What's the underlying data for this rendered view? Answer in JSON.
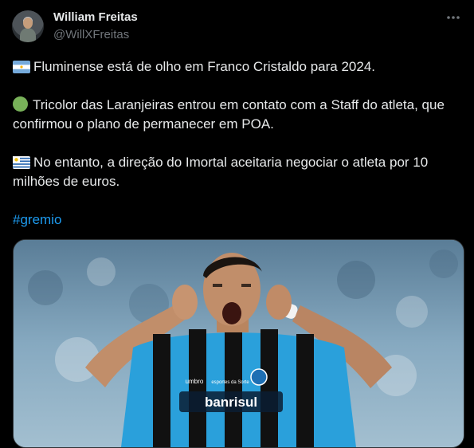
{
  "author": {
    "name": "William Freitas",
    "handle": "@WillXFreitas",
    "avatar_icon": "user-avatar"
  },
  "more_icon": "more-horizontal-icon",
  "tweet": {
    "paragraph1": "Fluminense está de olho em Franco Cristaldo para 2024.",
    "paragraph2_line1": "Tricolor das Laranjeiras entrou em contato com a Staff do atleta, que",
    "paragraph2_line2": "confirmou o plano de permanecer em POA.",
    "paragraph3_line1": "No entanto, a direção do Imortal aceitaria negociar o atleta por 10",
    "paragraph3_line2": "milhões de euros.",
    "hashtag": "#gremio"
  },
  "media": {
    "shirt_sponsor": "banrisul",
    "shirt_brand": "umbro",
    "chest_badge": "esportes da Sorte"
  },
  "colors": {
    "background": "#000000",
    "text": "#e7e9ea",
    "secondary": "#71767b",
    "link": "#1d9bf0",
    "green_circle": "#78b159"
  }
}
